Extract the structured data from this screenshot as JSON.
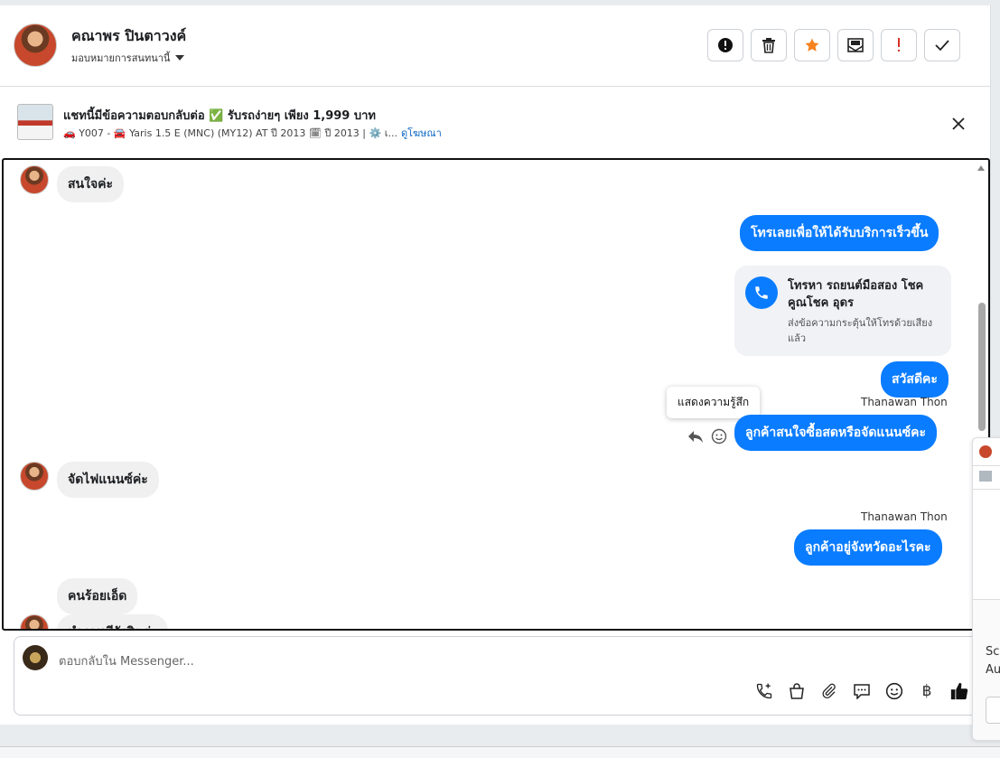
{
  "header": {
    "contact_name": "คณาพร ปินตาวงค์",
    "assign_label": "มอบหมายการสนทนานี้",
    "actions": [
      {
        "name": "report-icon",
        "glyph": "!"
      },
      {
        "name": "trash-icon",
        "glyph": "🗑"
      },
      {
        "name": "star-icon",
        "glyph": "★"
      },
      {
        "name": "mark-unread-icon",
        "glyph": "✉"
      },
      {
        "name": "spam-icon",
        "glyph": "!"
      },
      {
        "name": "done-icon",
        "glyph": "✓"
      }
    ]
  },
  "ad": {
    "title": "แชทนี้มีข้อความตอบกลับต่อ ✅ รับรถง่ายๆ เพียง 1,999 บาท",
    "subtitle": "🚗 Y007 - 🚘 Yaris 1.5 E (MNC) (MY12) AT ปี 2013 🗓 ปี 2013 | ⚙️ เ...",
    "link": "ดูโฆษณา"
  },
  "messages": {
    "m1": "สนใจค่ะ",
    "m2": "โทรเลยเพื่อให้ได้รับบริการเร็วขึ้น",
    "call_title": "โทรหา รถยนต์มือสอง โชคคูณโชค อุดร",
    "call_sub": "ส่งข้อความกระตุ้นให้โทรด้วยเสียงแล้ว",
    "m3": "สวัสดีคะ",
    "sender1": "Thanawan Thon",
    "m4": "ลูกค้าสนใจซื้อสดหรือจัดแนนซ์คะ",
    "m5": "จัดไฟแนนซ์ค่ะ",
    "sender2": "Thanawan Thon",
    "m6": "ลูกค้าอยู่จังหวัดอะไรคะ",
    "m7": "คนร้อยเอ็ด",
    "m8": "ทำงานมีรังสิตค่ะ"
  },
  "tooltip": "แสดงความรู้สึก",
  "composer": {
    "placeholder": "ตอบกลับใน Messenger...",
    "tools": [
      {
        "name": "call-add-icon",
        "glyph": "☏"
      },
      {
        "name": "shop-bag-icon",
        "glyph": "🛍"
      },
      {
        "name": "attach-icon",
        "glyph": "📎"
      },
      {
        "name": "saved-reply-icon",
        "glyph": "💬"
      },
      {
        "name": "emoji-icon",
        "glyph": "☺"
      },
      {
        "name": "baht-icon",
        "glyph": "฿"
      },
      {
        "name": "like-icon",
        "glyph": "👍"
      }
    ]
  },
  "side": {
    "text1": "Scr",
    "text2": "Au"
  },
  "colors": {
    "brand_blue": "#0a7cff",
    "star_orange": "#f5821f",
    "spam_red": "#d93025"
  }
}
